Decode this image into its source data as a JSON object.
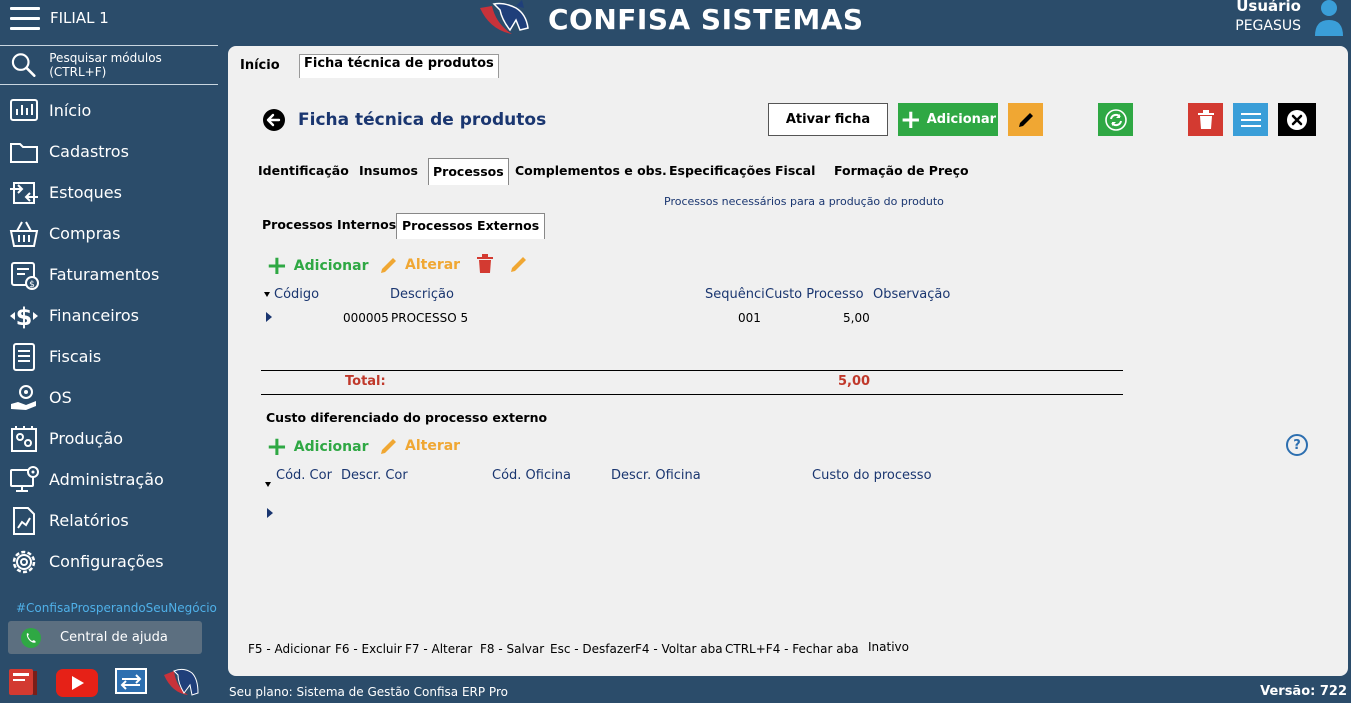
{
  "topbar": {
    "branch": "FILIAL 1",
    "brand": "CONFISA SISTEMAS",
    "user_label": "Usuário",
    "user_name": "PEGASUS"
  },
  "sidebar": {
    "search_label": "Pesquisar módulos (CTRL+F)",
    "items": [
      {
        "label": "Início",
        "icon": "dashboard-icon"
      },
      {
        "label": "Cadastros",
        "icon": "folder-icon"
      },
      {
        "label": "Estoques",
        "icon": "transfer-icon"
      },
      {
        "label": "Compras",
        "icon": "basket-icon"
      },
      {
        "label": "Faturamentos",
        "icon": "invoice-icon"
      },
      {
        "label": "Financeiros",
        "icon": "dollar-icon"
      },
      {
        "label": "Fiscais",
        "icon": "document-list-icon"
      },
      {
        "label": "OS",
        "icon": "hand-gear-icon"
      },
      {
        "label": "Produção",
        "icon": "production-icon"
      },
      {
        "label": "Administração",
        "icon": "monitor-gear-icon"
      },
      {
        "label": "Relatórios",
        "icon": "report-icon"
      },
      {
        "label": "Configurações",
        "icon": "gear-icon"
      }
    ],
    "hashtag": "#ConfisaProsperandoSeuNegócio",
    "help_label": "Central de ajuda"
  },
  "doc_tabs": [
    "Início",
    "Ficha técnica de produtos"
  ],
  "page": {
    "title": "Ficha técnica de produtos",
    "btn_ativar": "Ativar ficha",
    "btn_adicionar": "Adicionar"
  },
  "sub_tabs": [
    "Identificação",
    "Insumos",
    "Processos",
    "Complementos e obs.",
    "Especificações",
    "Fiscal",
    "Formação de Preço"
  ],
  "hint": "Processos necessários para a produção do produto",
  "inner_tabs": [
    "Processos Internos",
    "Processos Externos"
  ],
  "actions": {
    "adicionar": "Adicionar",
    "alterar": "Alterar"
  },
  "grid1": {
    "headers": [
      "Código",
      "Descrição",
      "Sequênci",
      "Custo Processo",
      "Observação"
    ],
    "rows": [
      {
        "codigo": "000005",
        "descricao": "PROCESSO 5",
        "sequencia": "001",
        "custo": "5,00",
        "observacao": ""
      }
    ],
    "total_label": "Total:",
    "total_value": "5,00"
  },
  "section2": {
    "title": "Custo diferenciado do processo externo",
    "headers": [
      "Cód. Cor",
      "Descr. Cor",
      "Cód. Oficina",
      "Descr. Oficina",
      "Custo do processo"
    ]
  },
  "shortcuts": [
    "F5 - Adicionar",
    "F6 - Excluir",
    "F7 - Alterar",
    "F8 - Salvar",
    "Esc - Desfazer",
    "F4 - Voltar aba",
    "CTRL+F4 - Fechar aba",
    "Inativo"
  ],
  "footer": {
    "plan": "Seu plano: Sistema de Gestão Confisa ERP Pro",
    "version": "Versão: 722"
  }
}
